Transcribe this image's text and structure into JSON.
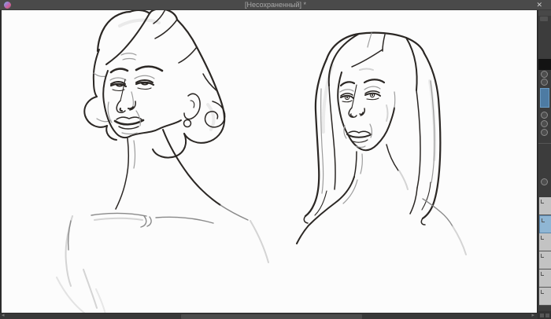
{
  "window": {
    "title": "[Несохраненный] *",
    "close_glyph": "✕"
  },
  "titlebar_icons": {
    "app_logo": "paint-app-logo"
  },
  "scrollbar": {
    "left_arrow": "◂",
    "right_arrow": "▸"
  },
  "colors": {
    "titlebar_bg": "#4a4a4a",
    "titlebar_text": "#a9a9a9",
    "canvas_bg": "#fcfcfc",
    "panel_bg": "#3c3c3c",
    "highlight_blue": "#4d7ba3",
    "layer_selected_blue": "#8fb6d4",
    "layer_item_gray": "#c3c3c3",
    "scrollbar_track": "#383838",
    "scrollbar_thumb": "#4c4c4c",
    "ink": "#2b2724",
    "sketch_light": "#9d9d9d"
  }
}
